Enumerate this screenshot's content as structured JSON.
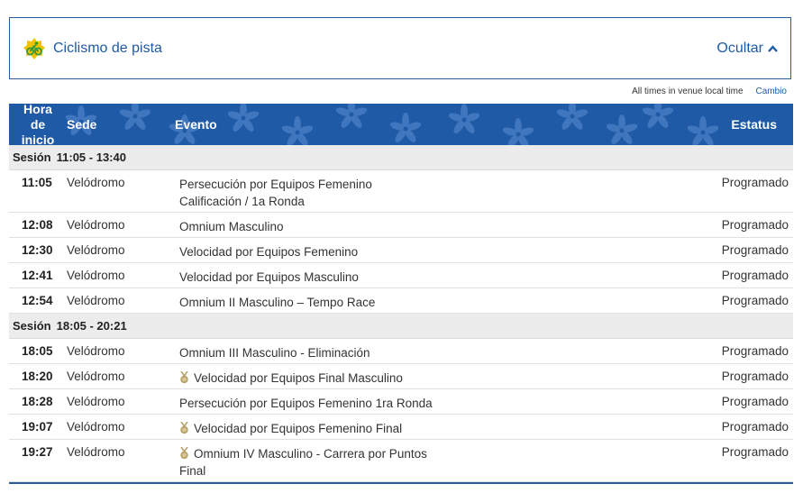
{
  "sport": {
    "icon": "cycling-icon",
    "name": "Ciclismo de pista",
    "toggle_label": "Ocultar"
  },
  "timezone": {
    "note": "All times in venue local time",
    "change_label": "Cambio"
  },
  "table": {
    "headers": {
      "time_line1": "Hora de",
      "time_line2": "inicio",
      "venue": "Sede",
      "event": "Evento",
      "status": "Estatus"
    },
    "sessions": [
      {
        "label": "Sesión",
        "time": "11:05 - 13:40",
        "rows": [
          {
            "time": "11:05",
            "venue": "Velódromo",
            "event_line1": "Persecución por Equipos Femenino",
            "event_line2": "Calificación / 1a Ronda",
            "medal": false,
            "status": "Programado"
          },
          {
            "time": "12:08",
            "venue": "Velódromo",
            "event_line1": "Omnium Masculino",
            "event_line2": "",
            "medal": false,
            "status": "Programado"
          },
          {
            "time": "12:30",
            "venue": "Velódromo",
            "event_line1": "Velocidad por Equipos Femenino",
            "event_line2": "",
            "medal": false,
            "status": "Programado"
          },
          {
            "time": "12:41",
            "venue": "Velódromo",
            "event_line1": "Velocidad por Equipos Masculino",
            "event_line2": "",
            "medal": false,
            "status": "Programado"
          },
          {
            "time": "12:54",
            "venue": "Velódromo",
            "event_line1": "Omnium II Masculino – Tempo Race",
            "event_line2": "",
            "medal": false,
            "status": "Programado"
          }
        ]
      },
      {
        "label": "Sesión",
        "time": "18:05 - 20:21",
        "rows": [
          {
            "time": "18:05",
            "venue": "Velódromo",
            "event_line1": "Omnium III Masculino - Eliminación",
            "event_line2": "",
            "medal": false,
            "status": "Programado"
          },
          {
            "time": "18:20",
            "venue": "Velódromo",
            "event_line1": "Velocidad por Equipos Final Masculino",
            "event_line2": "",
            "medal": true,
            "status": "Programado"
          },
          {
            "time": "18:28",
            "venue": "Velódromo",
            "event_line1": "Persecución por Equipos Femenino 1ra Ronda",
            "event_line2": "",
            "medal": false,
            "status": "Programado"
          },
          {
            "time": "19:07",
            "venue": "Velódromo",
            "event_line1": "Velocidad por Equipos Femenino Final",
            "event_line2": "",
            "medal": true,
            "status": "Programado"
          },
          {
            "time": "19:27",
            "venue": "Velódromo",
            "event_line1": "Omnium IV Masculino - Carrera por Puntos",
            "event_line2": "Final",
            "medal": true,
            "status": "Programado"
          }
        ]
      }
    ]
  },
  "colors": {
    "brand_blue": "#1f5aa6",
    "session_bg": "#ececec",
    "medal_gold": "#b8a06a",
    "icon_yellow": "#f2c200",
    "icon_green": "#2e9a3e"
  }
}
